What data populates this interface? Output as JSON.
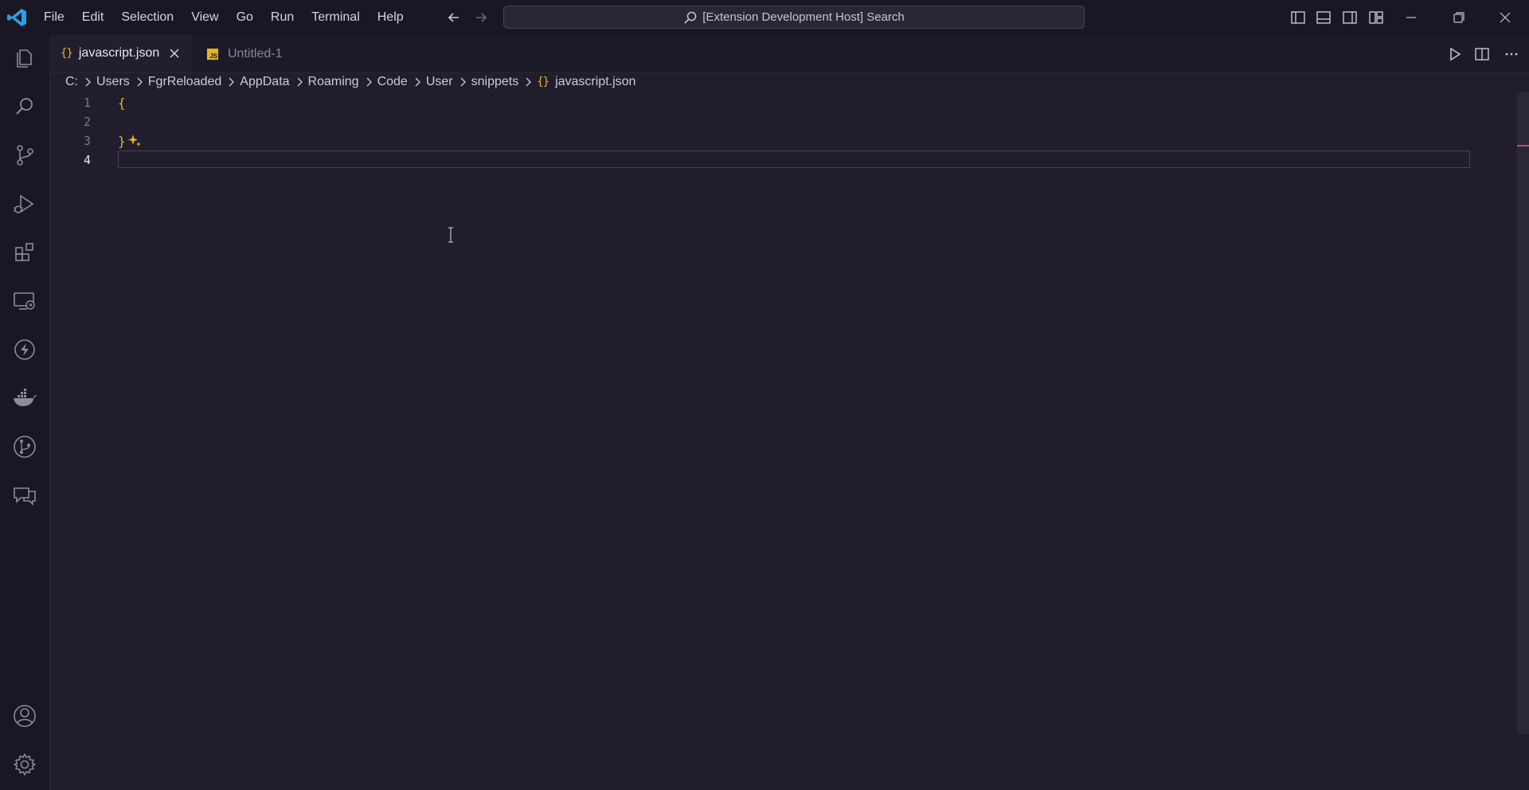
{
  "window": {
    "menu": [
      "File",
      "Edit",
      "Selection",
      "View",
      "Go",
      "Run",
      "Terminal",
      "Help"
    ],
    "command_center": "[Extension Development Host] Search"
  },
  "icons": {
    "app": "vscode-logo",
    "activity_top": [
      "explorer-icon",
      "search-icon",
      "source-control-icon",
      "run-debug-icon",
      "extensions-icon",
      "remote-explorer-icon",
      "lightning-icon",
      "docker-icon",
      "git-graph-icon",
      "chat-icon"
    ],
    "activity_bottom": [
      "account-icon",
      "settings-gear-icon"
    ]
  },
  "tabs": [
    {
      "label": "javascript.json",
      "icon": "{}",
      "active": true
    },
    {
      "label": "Untitled-1",
      "icon": "JS",
      "active": false
    }
  ],
  "breadcrumb": [
    "C:",
    "Users",
    "FgrReloaded",
    "AppData",
    "Roaming",
    "Code",
    "User",
    "snippets",
    "javascript.json"
  ],
  "breadcrumb_file_icon": "{}",
  "editor": {
    "lines": [
      {
        "number": "1",
        "text": "{"
      },
      {
        "number": "2",
        "text": ""
      },
      {
        "number": "3",
        "text": "}"
      },
      {
        "number": "4",
        "text": ""
      }
    ],
    "current_line": 4
  },
  "colors": {
    "accent_yellow": "#e6b422",
    "background": "#211d2c",
    "chrome": "#1a1724",
    "logo_blue": "#2b9fe6"
  }
}
